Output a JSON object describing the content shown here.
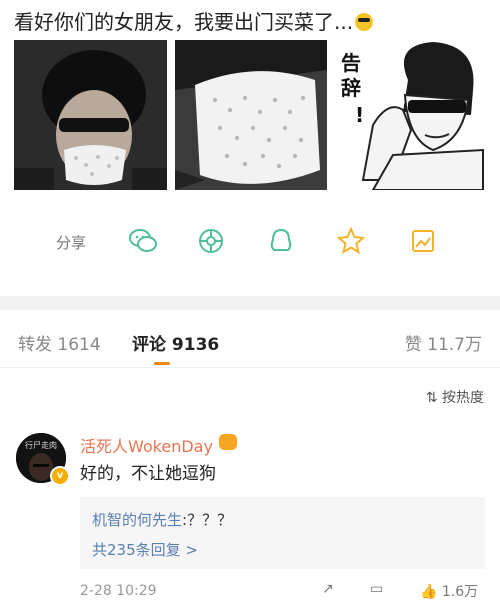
{
  "post": {
    "text": "看好你们的女朋友，我要出门买菜了...",
    "emoji": "sunglasses-emoji"
  },
  "meme": {
    "caption_line1": "告",
    "caption_line2": "辞",
    "exclaim": "!"
  },
  "share": {
    "label": "分享"
  },
  "tabs": {
    "repost": "转发 1614",
    "comments": "评论 9136",
    "likes": "赞 11.7万"
  },
  "sort": {
    "label": "按热度"
  },
  "comment": {
    "avatar_text": "行尸走肉",
    "badge": "v",
    "username": "活死人WokenDay",
    "text": "好的，不让她逗狗",
    "reply_name": "机智的何先生",
    "reply_text": ":？？？",
    "reply_more": "共235条回复 >",
    "time": "2-28 10:29",
    "like_count": "1.6万"
  },
  "colors": {
    "accent": "#f28a1d",
    "username": "#eb7350",
    "link": "#5a7fb0",
    "share_icon": "#4fbf9a"
  }
}
